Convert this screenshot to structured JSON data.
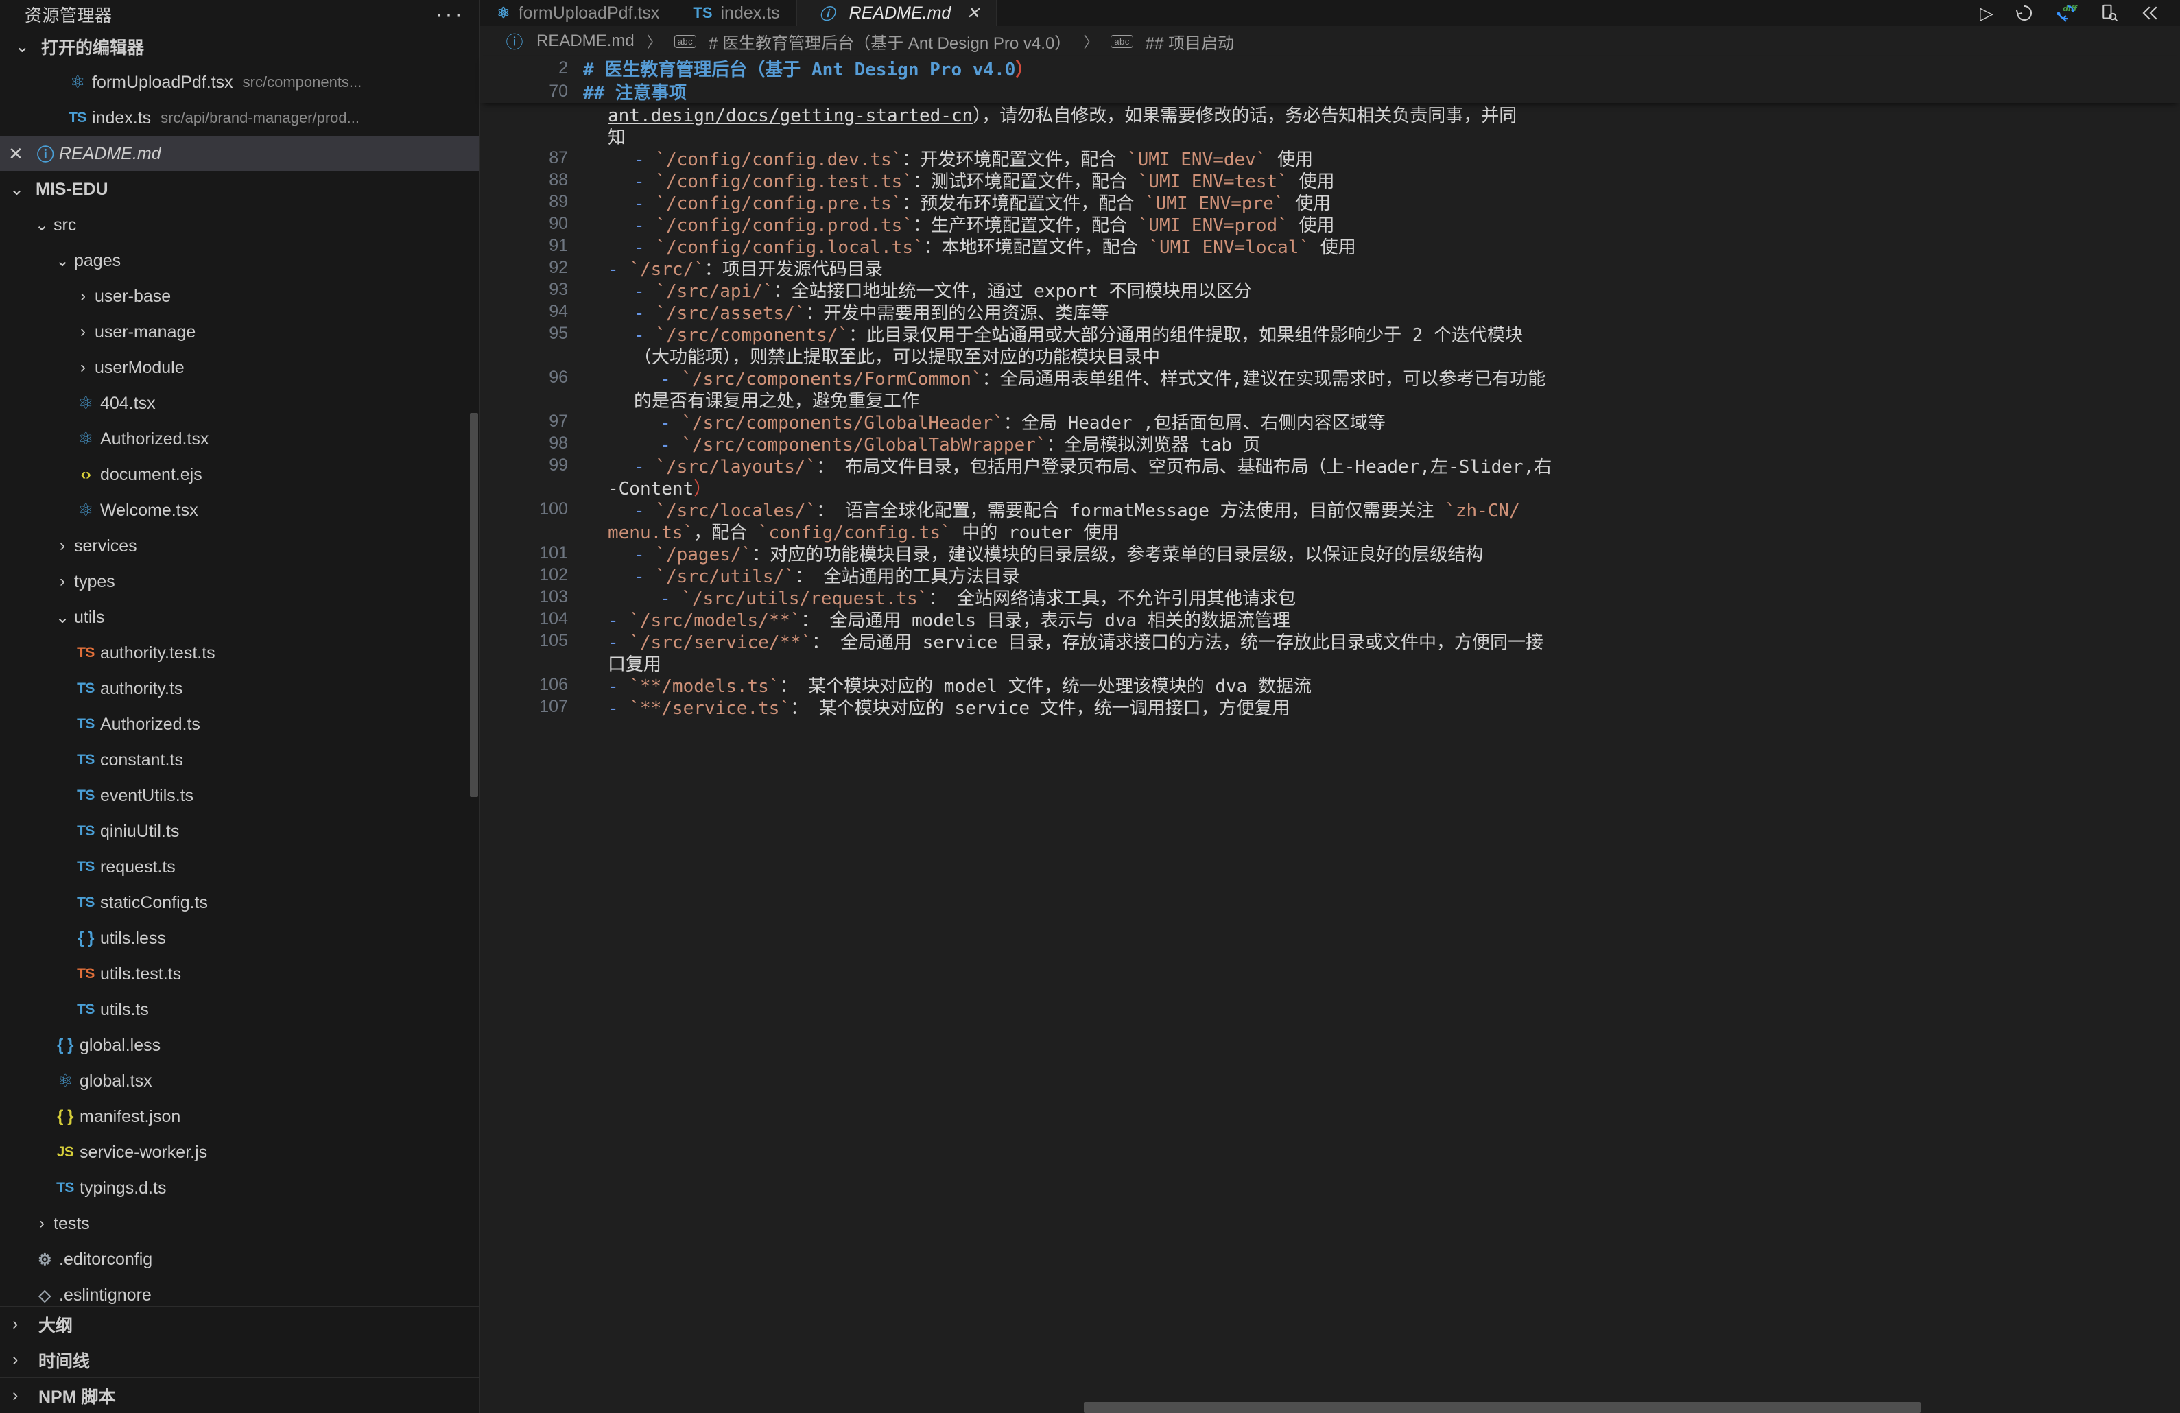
{
  "sidebar": {
    "title": "资源管理器",
    "more_label": "···",
    "open_editors": {
      "label": "打开的编辑器",
      "items": [
        {
          "name": "formUploadPdf.tsx",
          "desc": "src/components...",
          "icon": "react-icon",
          "icon_glyph": "⚛",
          "selected": false,
          "closable": false
        },
        {
          "name": "index.ts",
          "desc": "src/api/brand-manager/prod...",
          "icon": "ts-icon",
          "icon_glyph": "TS",
          "selected": false,
          "closable": false
        },
        {
          "name": "README.md",
          "desc": "",
          "icon": "info-icon",
          "icon_glyph": "ⓘ",
          "selected": true,
          "closable": true,
          "close_glyph": "✕"
        }
      ]
    },
    "project": {
      "label": "MIS-EDU",
      "items": [
        {
          "label": "src",
          "type": "folder",
          "expanded": true,
          "indent": 1
        },
        {
          "label": "pages",
          "type": "folder",
          "expanded": true,
          "indent": 2
        },
        {
          "label": "user-base",
          "type": "folder",
          "expanded": false,
          "indent": 3
        },
        {
          "label": "user-manage",
          "type": "folder",
          "expanded": false,
          "indent": 3
        },
        {
          "label": "userModule",
          "type": "folder",
          "expanded": false,
          "indent": 3
        },
        {
          "label": "404.tsx",
          "type": "react",
          "indent": 3
        },
        {
          "label": "Authorized.tsx",
          "type": "react",
          "indent": 3
        },
        {
          "label": "document.ejs",
          "type": "code",
          "indent": 3
        },
        {
          "label": "Welcome.tsx",
          "type": "react",
          "indent": 3
        },
        {
          "label": "services",
          "type": "folder",
          "expanded": false,
          "indent": 2
        },
        {
          "label": "types",
          "type": "folder",
          "expanded": false,
          "indent": 2
        },
        {
          "label": "utils",
          "type": "folder",
          "expanded": true,
          "indent": 2
        },
        {
          "label": "authority.test.ts",
          "type": "ts-test",
          "indent": 3
        },
        {
          "label": "authority.ts",
          "type": "ts",
          "indent": 3
        },
        {
          "label": "Authorized.ts",
          "type": "ts",
          "indent": 3
        },
        {
          "label": "constant.ts",
          "type": "ts",
          "indent": 3
        },
        {
          "label": "eventUtils.ts",
          "type": "ts",
          "indent": 3
        },
        {
          "label": "qiniuUtil.ts",
          "type": "ts",
          "indent": 3
        },
        {
          "label": "request.ts",
          "type": "ts",
          "indent": 3
        },
        {
          "label": "staticConfig.ts",
          "type": "ts",
          "indent": 3
        },
        {
          "label": "utils.less",
          "type": "less",
          "indent": 3
        },
        {
          "label": "utils.test.ts",
          "type": "ts-test",
          "indent": 3
        },
        {
          "label": "utils.ts",
          "type": "ts",
          "indent": 3
        },
        {
          "label": "global.less",
          "type": "less",
          "indent": 2
        },
        {
          "label": "global.tsx",
          "type": "react",
          "indent": 2
        },
        {
          "label": "manifest.json",
          "type": "json",
          "indent": 2
        },
        {
          "label": "service-worker.js",
          "type": "js",
          "indent": 2
        },
        {
          "label": "typings.d.ts",
          "type": "ts",
          "indent": 2
        },
        {
          "label": "tests",
          "type": "folder",
          "expanded": false,
          "indent": 1
        },
        {
          "label": ".editorconfig",
          "type": "gear",
          "indent": 1
        },
        {
          "label": ".eslintignore",
          "type": "lint",
          "indent": 1
        }
      ]
    },
    "panels": [
      {
        "label": "大纲"
      },
      {
        "label": "时间线"
      },
      {
        "label": "NPM 脚本"
      }
    ]
  },
  "tabs": [
    {
      "label": "formUploadPdf.tsx",
      "icon_glyph": "⚛",
      "icon_class": "react",
      "active": false,
      "closable": false
    },
    {
      "label": "index.ts",
      "icon_glyph": "TS",
      "icon_class": "ts",
      "active": false,
      "closable": false
    },
    {
      "label": "README.md",
      "icon_glyph": "ⓘ",
      "icon_class": "info-i",
      "active": true,
      "closable": true,
      "close_glyph": "✕"
    }
  ],
  "toolbar": {
    "run_label": "▷",
    "history_label": "↺",
    "diff_label": "diff",
    "preview_label": "▭",
    "split_label": "«"
  },
  "breadcrumb": {
    "file": "README.md",
    "items": [
      {
        "label": "# 医生教育管理后台（基于 Ant Design Pro v4.0）",
        "symbol": "abc"
      },
      {
        "label": "## 项目启动",
        "symbol": "abc"
      }
    ],
    "separator": "〉"
  },
  "sticky_lines": [
    {
      "num": "2",
      "kind": "h1",
      "text": "# 医生教育管理后台（基于 Ant Design Pro v4.0）"
    },
    {
      "num": "70",
      "kind": "h2",
      "text": "## 注意事项"
    }
  ],
  "editor_lines": [
    {
      "num": "",
      "indent": 0,
      "segments": [
        {
          "t": "ant.design/docs/getting-started-cn",
          "c": "link-u"
        },
        {
          "t": "），请勿私自修改，如果需要修改的话，务必告知相关负责同事，并同",
          "c": "plain"
        }
      ]
    },
    {
      "num": "",
      "indent": 0,
      "segments": [
        {
          "t": "知",
          "c": "plain"
        }
      ]
    },
    {
      "num": "87",
      "indent": 1,
      "segments": [
        {
          "t": "- ",
          "c": "bullet"
        },
        {
          "t": "`/config/config.dev.ts`",
          "c": "code-inline"
        },
        {
          "t": "：开发环境配置文件，配合 ",
          "c": "plain"
        },
        {
          "t": "`UMI_ENV=dev`",
          "c": "code-inline"
        },
        {
          "t": " 使用",
          "c": "plain"
        }
      ]
    },
    {
      "num": "88",
      "indent": 1,
      "segments": [
        {
          "t": "- ",
          "c": "bullet"
        },
        {
          "t": "`/config/config.test.ts`",
          "c": "code-inline"
        },
        {
          "t": "：测试环境配置文件，配合 ",
          "c": "plain"
        },
        {
          "t": "`UMI_ENV=test`",
          "c": "code-inline"
        },
        {
          "t": " 使用",
          "c": "plain"
        }
      ]
    },
    {
      "num": "89",
      "indent": 1,
      "segments": [
        {
          "t": "- ",
          "c": "bullet"
        },
        {
          "t": "`/config/config.pre.ts`",
          "c": "code-inline"
        },
        {
          "t": "：预发布环境配置文件，配合 ",
          "c": "plain"
        },
        {
          "t": "`UMI_ENV=pre`",
          "c": "code-inline"
        },
        {
          "t": " 使用",
          "c": "plain"
        }
      ]
    },
    {
      "num": "90",
      "indent": 1,
      "segments": [
        {
          "t": "- ",
          "c": "bullet"
        },
        {
          "t": "`/config/config.prod.ts`",
          "c": "code-inline"
        },
        {
          "t": "：生产环境配置文件，配合 ",
          "c": "plain"
        },
        {
          "t": "`UMI_ENV=prod`",
          "c": "code-inline"
        },
        {
          "t": " 使用",
          "c": "plain"
        }
      ]
    },
    {
      "num": "91",
      "indent": 1,
      "segments": [
        {
          "t": "- ",
          "c": "bullet"
        },
        {
          "t": "`/config/config.local.ts`",
          "c": "code-inline"
        },
        {
          "t": "：本地环境配置文件，配合 ",
          "c": "plain"
        },
        {
          "t": "`UMI_ENV=local`",
          "c": "code-inline"
        },
        {
          "t": " 使用",
          "c": "plain"
        }
      ]
    },
    {
      "num": "92",
      "indent": 0,
      "segments": [
        {
          "t": "- ",
          "c": "bullet"
        },
        {
          "t": "`/src/`",
          "c": "code-inline"
        },
        {
          "t": "：项目开发源代码目录",
          "c": "plain"
        }
      ]
    },
    {
      "num": "93",
      "indent": 1,
      "segments": [
        {
          "t": "- ",
          "c": "bullet"
        },
        {
          "t": "`/src/api/`",
          "c": "code-inline"
        },
        {
          "t": "：全站接口地址统一文件，通过 export 不同模块用以区分",
          "c": "plain"
        }
      ]
    },
    {
      "num": "94",
      "indent": 1,
      "segments": [
        {
          "t": "- ",
          "c": "bullet"
        },
        {
          "t": "`/src/assets/`",
          "c": "code-inline"
        },
        {
          "t": "：开发中需要用到的公用资源、类库等",
          "c": "plain"
        }
      ]
    },
    {
      "num": "95",
      "indent": 1,
      "segments": [
        {
          "t": "- ",
          "c": "bullet"
        },
        {
          "t": "`/src/components/`",
          "c": "code-inline"
        },
        {
          "t": "：此目录仅用于全站通用或大部分通用的组件提取，如果组件影响少于 2 个迭代模块",
          "c": "plain"
        }
      ]
    },
    {
      "num": "",
      "indent": 1,
      "wrap": true,
      "segments": [
        {
          "t": "（大功能项），则禁止提取至此，可以提取至对应的功能模块目录中",
          "c": "plain"
        }
      ]
    },
    {
      "num": "96",
      "indent": 2,
      "segments": [
        {
          "t": "- ",
          "c": "bullet"
        },
        {
          "t": "`/src/components/FormCommon`",
          "c": "code-inline"
        },
        {
          "t": "：全局通用表单组件、样式文件,建议在实现需求时，可以参考已有功能",
          "c": "plain"
        }
      ]
    },
    {
      "num": "",
      "indent": 1,
      "wrap": true,
      "segments": [
        {
          "t": "的是否有课复用之处，避免重复工作",
          "c": "plain"
        }
      ]
    },
    {
      "num": "97",
      "indent": 2,
      "segments": [
        {
          "t": "- ",
          "c": "bullet"
        },
        {
          "t": "`/src/components/GlobalHeader`",
          "c": "code-inline"
        },
        {
          "t": "：全局 Header ,包括面包屑、右侧内容区域等",
          "c": "plain"
        }
      ]
    },
    {
      "num": "98",
      "indent": 2,
      "segments": [
        {
          "t": "- ",
          "c": "bullet"
        },
        {
          "t": "`/src/components/GlobalTabWrapper`",
          "c": "code-inline"
        },
        {
          "t": "：全局模拟浏览器 tab 页",
          "c": "plain"
        }
      ]
    },
    {
      "num": "99",
      "indent": 1,
      "segments": [
        {
          "t": "- ",
          "c": "bullet"
        },
        {
          "t": "`/src/layouts/`",
          "c": "code-inline"
        },
        {
          "t": "： 布局文件目录，包括用户登录页布局、空页布局、基础布局（上-Header,左-Slider,右",
          "c": "plain"
        }
      ]
    },
    {
      "num": "",
      "indent": 0,
      "wrap": true,
      "segments": [
        {
          "t": "-Content",
          "c": "plain"
        },
        {
          "t": "）",
          "c": "paren-red"
        }
      ]
    },
    {
      "num": "100",
      "indent": 1,
      "segments": [
        {
          "t": "- ",
          "c": "bullet"
        },
        {
          "t": "`/src/locales/`",
          "c": "code-inline"
        },
        {
          "t": "： 语言全球化配置，需要配合 formatMessage 方法使用，目前仅需要关注 ",
          "c": "plain"
        },
        {
          "t": "`zh-CN/",
          "c": "code-inline"
        }
      ]
    },
    {
      "num": "",
      "indent": 0,
      "wrap": true,
      "segments": [
        {
          "t": "menu.ts`",
          "c": "code-inline"
        },
        {
          "t": "，配合 ",
          "c": "plain"
        },
        {
          "t": "`config/config.ts`",
          "c": "code-inline"
        },
        {
          "t": " 中的 router 使用",
          "c": "plain"
        }
      ]
    },
    {
      "num": "101",
      "indent": 1,
      "segments": [
        {
          "t": "- ",
          "c": "bullet"
        },
        {
          "t": "`/pages/`",
          "c": "code-inline"
        },
        {
          "t": "：对应的功能模块目录，建议模块的目录层级，参考菜单的目录层级，以保证良好的层级结构",
          "c": "plain"
        }
      ]
    },
    {
      "num": "102",
      "indent": 1,
      "segments": [
        {
          "t": "- ",
          "c": "bullet"
        },
        {
          "t": "`/src/utils/`",
          "c": "code-inline"
        },
        {
          "t": "： 全站通用的工具方法目录",
          "c": "plain"
        }
      ]
    },
    {
      "num": "103",
      "indent": 2,
      "segments": [
        {
          "t": "- ",
          "c": "bullet"
        },
        {
          "t": "`/src/utils/request.ts`",
          "c": "code-inline"
        },
        {
          "t": "： 全站网络请求工具，不允许引用其他请求包",
          "c": "plain"
        }
      ]
    },
    {
      "num": "104",
      "indent": 0,
      "segments": [
        {
          "t": "- ",
          "c": "bullet"
        },
        {
          "t": "`/src/models/**`",
          "c": "code-inline"
        },
        {
          "t": "： 全局通用 models 目录，表示与 dva 相关的数据流管理",
          "c": "plain"
        }
      ]
    },
    {
      "num": "105",
      "indent": 0,
      "segments": [
        {
          "t": "- ",
          "c": "bullet"
        },
        {
          "t": "`/src/service/**`",
          "c": "code-inline"
        },
        {
          "t": "： 全局通用 service 目录，存放请求接口的方法，统一存放此目录或文件中，方便同一接",
          "c": "plain"
        }
      ]
    },
    {
      "num": "",
      "indent": 0,
      "wrap": true,
      "segments": [
        {
          "t": "口复用",
          "c": "plain"
        }
      ]
    },
    {
      "num": "106",
      "indent": 0,
      "segments": [
        {
          "t": "- ",
          "c": "bullet"
        },
        {
          "t": "`**/models.ts`",
          "c": "code-inline"
        },
        {
          "t": "： 某个模块对应的 model 文件，统一处理该模块的 dva 数据流",
          "c": "plain"
        }
      ]
    },
    {
      "num": "107",
      "indent": 0,
      "segments": [
        {
          "t": "- ",
          "c": "bullet"
        },
        {
          "t": "`**/service.ts`",
          "c": "code-inline"
        },
        {
          "t": "： 某个模块对应的 service 文件，统一调用接口，方便复用",
          "c": "plain"
        }
      ]
    }
  ]
}
